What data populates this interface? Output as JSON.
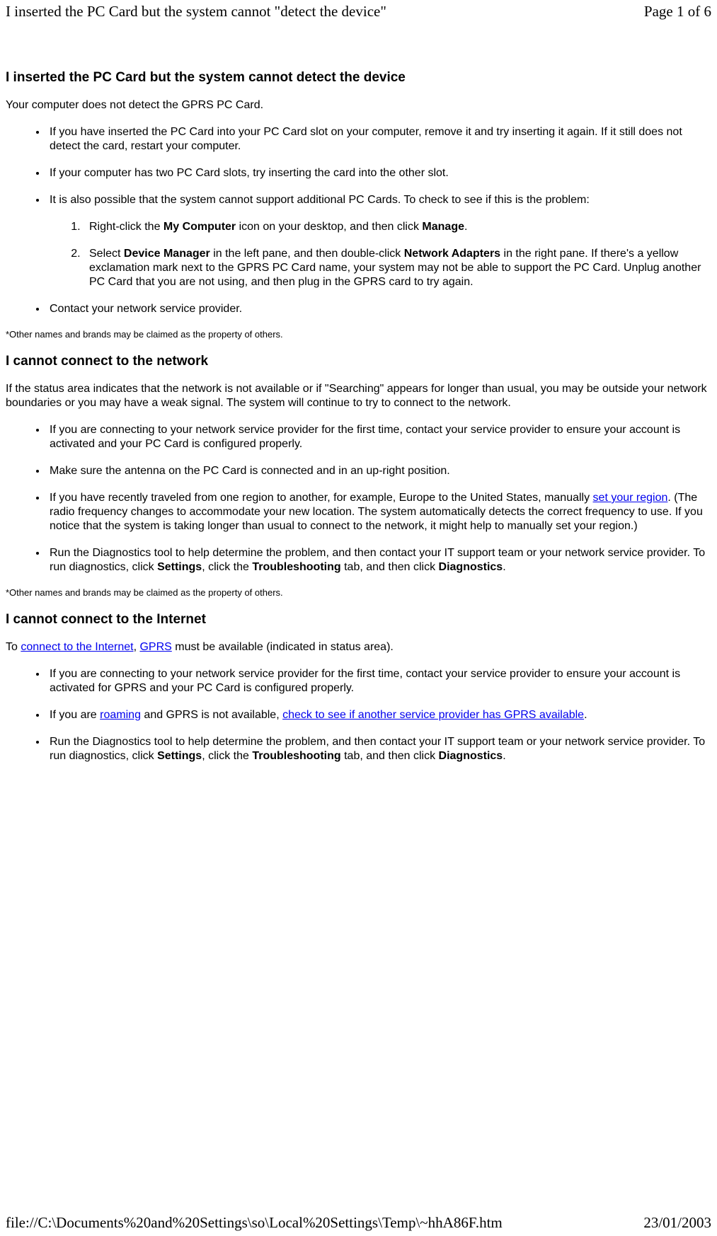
{
  "header": {
    "title": "I inserted the PC Card but the system cannot \"detect the device\"",
    "page_indicator": "Page 1 of 6"
  },
  "footer": {
    "path": "file://C:\\Documents%20and%20Settings\\so\\Local%20Settings\\Temp\\~hhA86F.htm",
    "date": "23/01/2003"
  },
  "section1": {
    "title": "I inserted the PC Card but the system cannot detect the device",
    "intro": "Your computer does not detect the GPRS PC Card.",
    "bullets": {
      "b1": "If you have inserted the PC Card into your PC Card slot on your computer, remove it and try inserting it again. If it still does not detect the card, restart your computer.",
      "b2": "If your computer has two PC Card slots, try inserting the card into the other slot.",
      "b3": "It is also possible that the system cannot support additional PC Cards. To check to see if this is the problem:",
      "nested": {
        "n1_pre": "Right-click the ",
        "n1_b1": "My Computer",
        "n1_mid": " icon on your desktop, and then click ",
        "n1_b2": "Manage",
        "n1_post": ".",
        "n2_pre": "Select ",
        "n2_b1": "Device Manager",
        "n2_mid1": " in the left pane, and then double-click ",
        "n2_b2": "Network Adapters",
        "n2_post": " in the right pane. If there's a yellow exclamation mark next to the GPRS PC Card name, your system may not be able to support the PC Card. Unplug another PC Card that you are not using, and then plug in the GPRS card to try again."
      },
      "b4": "Contact your network service provider."
    },
    "footnote": "*Other names and brands may be claimed as the property of others."
  },
  "section2": {
    "title": "I cannot connect to the network",
    "intro": "If the status area indicates that the network is not available or if \"Searching\" appears for longer than usual, you may be outside your network boundaries or you may have a weak signal. The system will continue to try to connect to the network.",
    "bullets": {
      "b1": "If you are connecting to your network service provider for the first time, contact your service provider to ensure your account is activated and your PC Card is configured properly.",
      "b2": "Make sure the antenna on the PC Card is connected and in an up-right position.",
      "b3_pre": "If you have recently traveled from one region to another, for example, Europe to the United States, manually ",
      "b3_link": "set your region",
      "b3_post": ". (The radio frequency changes to accommodate your new location. The system automatically detects the correct frequency to use. If you notice that the system is taking longer than usual to connect to the network, it might help to manually set your region.)",
      "b4_pre": "Run the Diagnostics tool to help determine the problem, and then contact your IT support team or your network service provider. To run diagnostics, click ",
      "b4_b1": "Settings",
      "b4_mid1": ", click the ",
      "b4_b2": "Troubleshooting",
      "b4_mid2": " tab, and then click ",
      "b4_b3": "Diagnostics",
      "b4_post": "."
    },
    "footnote": "*Other names and brands may be claimed as the property of others."
  },
  "section3": {
    "title": "I cannot connect to the Internet",
    "intro_pre": "To ",
    "intro_link1": "connect to the Internet",
    "intro_mid": ", ",
    "intro_link2": "GPRS",
    "intro_post": " must be available (indicated in status area).",
    "bullets": {
      "b1": "If you are connecting to your network service provider for the first time, contact your service provider to ensure your account is activated for GPRS and your PC Card is configured properly.",
      "b2_pre": "If you are ",
      "b2_link1": "roaming",
      "b2_mid": " and GPRS is not available, ",
      "b2_link2": "check to see if another service provider has GPRS available",
      "b2_post": ".",
      "b3_pre": "Run the Diagnostics tool to help determine the problem, and then contact your IT support team or your network service provider. To run diagnostics, click ",
      "b3_b1": "Settings",
      "b3_mid1": ", click the ",
      "b3_b2": "Troubleshooting",
      "b3_mid2": " tab, and then click ",
      "b3_b3": "Diagnostics",
      "b3_post": "."
    }
  }
}
